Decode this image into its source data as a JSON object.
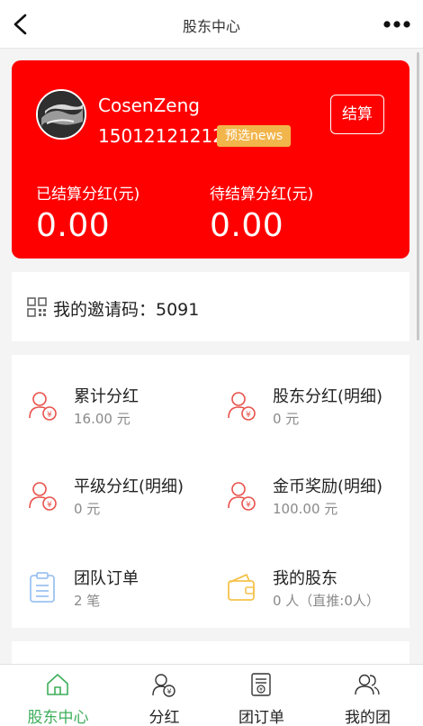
{
  "nav": {
    "title": "股东中心"
  },
  "profile": {
    "username": "CosenZeng",
    "phone": "15012121212",
    "tag": "预选news",
    "settle_label": "结算"
  },
  "stats": {
    "settled_label": "已结算分红(元)",
    "settled_value": "0.00",
    "pending_label": "待结算分红(元)",
    "pending_value": "0.00"
  },
  "invite": {
    "text": "我的邀请码：5091"
  },
  "menu": [
    {
      "label": "累计分红",
      "sub": "16.00 元",
      "icon": "user-yen-icon"
    },
    {
      "label": "股东分红(明细)",
      "sub": "0 元",
      "icon": "user-yen-icon"
    },
    {
      "label": "平级分红(明细)",
      "sub": "0 元",
      "icon": "user-yen-icon"
    },
    {
      "label": "金币奖励(明细)",
      "sub": "100.00 元",
      "icon": "user-yen-icon"
    },
    {
      "label": "团队订单",
      "sub": "2 笔",
      "icon": "clipboard-icon"
    },
    {
      "label": "我的股东",
      "sub": "0 人（直推:0人）",
      "icon": "wallet-icon"
    }
  ],
  "tabs": [
    {
      "label": "股东中心",
      "icon": "home-icon",
      "active": true
    },
    {
      "label": "分红",
      "icon": "user-yen-icon",
      "active": false
    },
    {
      "label": "团订单",
      "icon": "order-icon",
      "active": false
    },
    {
      "label": "我的团",
      "icon": "team-icon",
      "active": false
    }
  ],
  "colors": {
    "accent_red": "#ff0000",
    "tag_bg": "#f1b54b",
    "icon_red": "#e8514a",
    "icon_blue": "#9dc3f0",
    "icon_yellow": "#f5c24c",
    "tab_active": "#3dae5a"
  }
}
